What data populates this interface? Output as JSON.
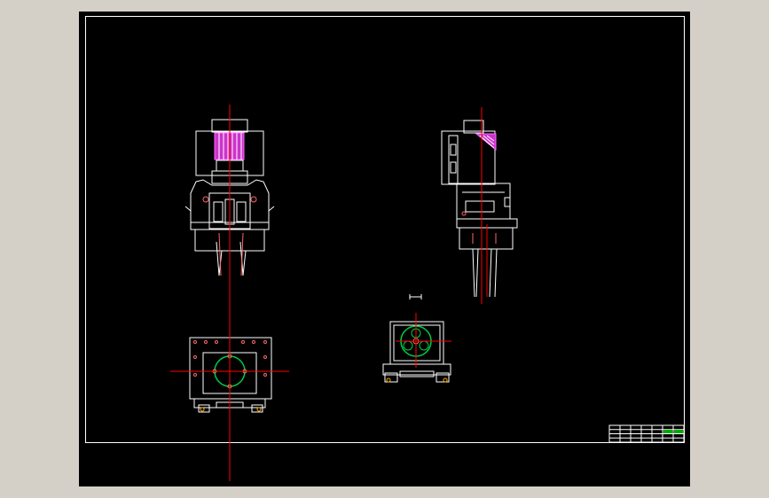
{
  "window": {
    "background": "#d4d0c8",
    "viewport_background": "#000000"
  },
  "colors": {
    "outline": "#ffffff",
    "centerline": "#ff0000",
    "motor_fill": "#cc33cc",
    "circle": "#00cc44",
    "marker": "#ff6666",
    "title_block_fill": "#00aa00"
  },
  "drawing": {
    "views": [
      "front-view",
      "side-view",
      "top-view",
      "detail-view"
    ],
    "title_block": {
      "rows": 4,
      "columns": 7
    }
  }
}
